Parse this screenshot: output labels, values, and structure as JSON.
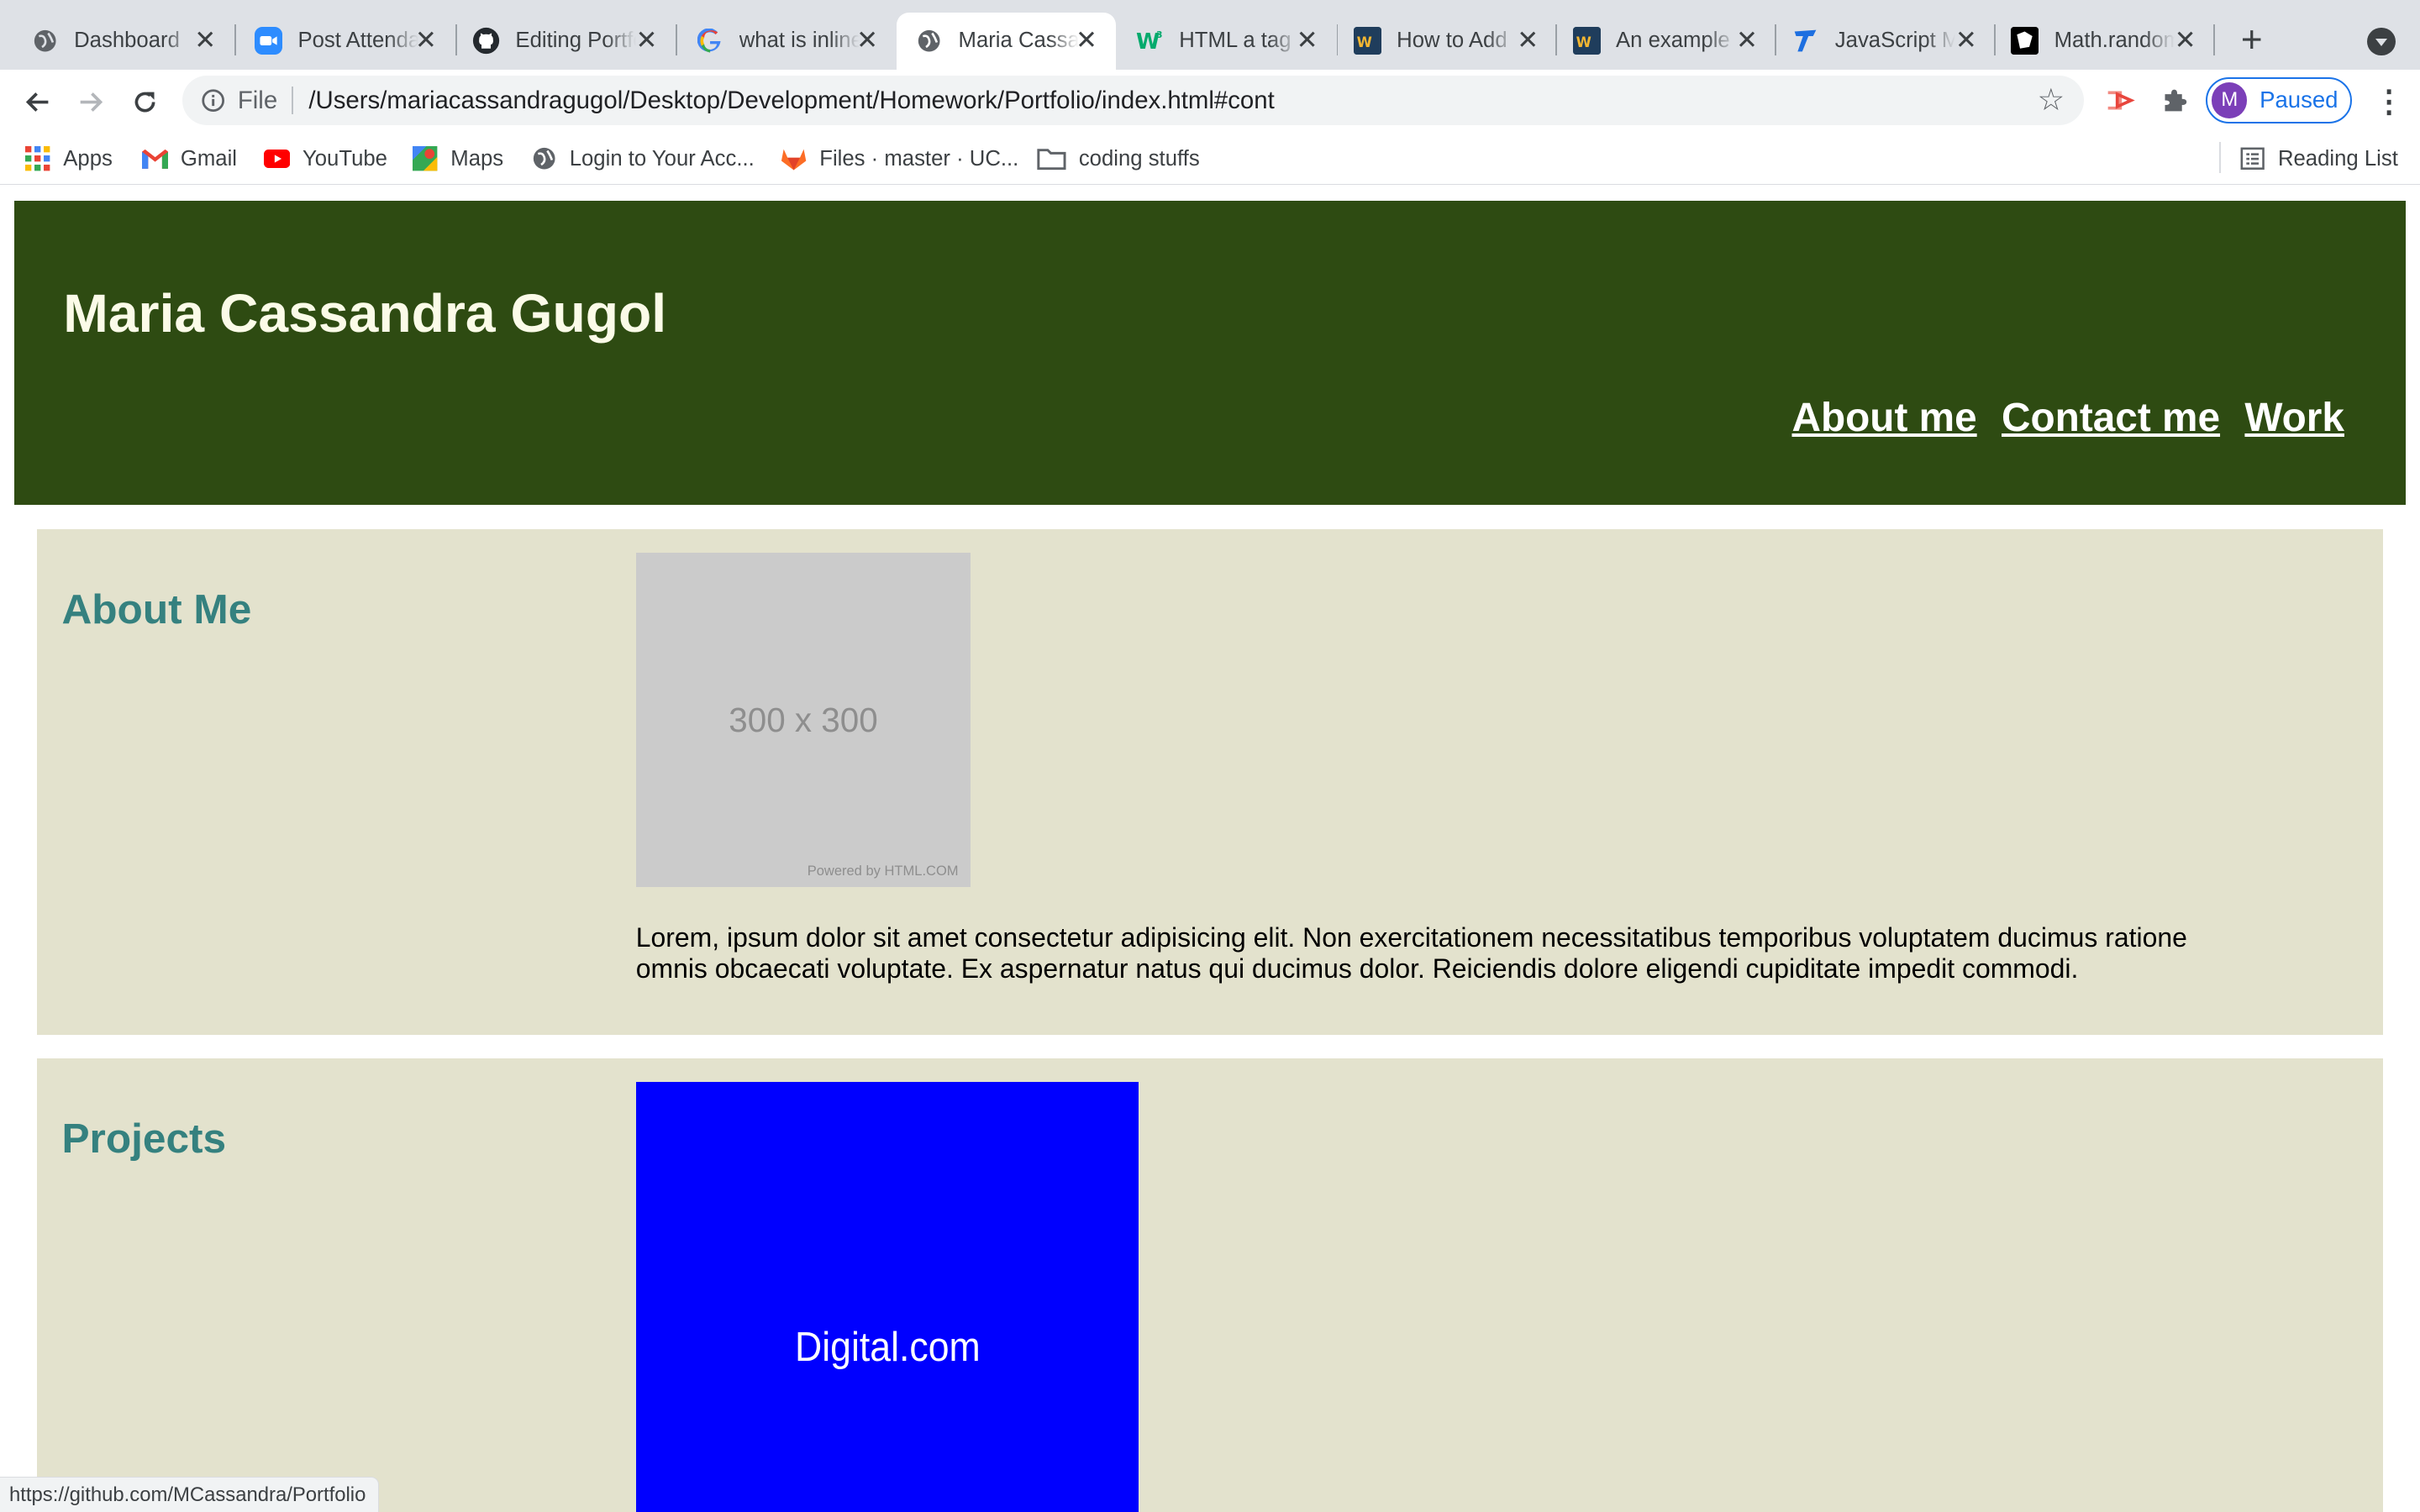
{
  "browser": {
    "tabs": [
      {
        "title": "Dashboard",
        "icon": "globe-icon",
        "active": false
      },
      {
        "title": "Post Attendance",
        "icon": "zoom-icon",
        "active": false
      },
      {
        "title": "Editing Portfolio",
        "icon": "github-icon",
        "active": false
      },
      {
        "title": "what is inline",
        "icon": "google-icon",
        "active": false
      },
      {
        "title": "Maria Cassandra",
        "icon": "globe-icon",
        "active": true
      },
      {
        "title": "HTML a tag",
        "icon": "w3schools-icon",
        "active": false
      },
      {
        "title": "How to Add",
        "icon": "webucator-icon",
        "active": false
      },
      {
        "title": "An example",
        "icon": "webucator-icon",
        "active": false
      },
      {
        "title": "JavaScript Math",
        "icon": "tutorial-icon",
        "active": false
      },
      {
        "title": "Math.random",
        "icon": "mdn-icon",
        "active": false
      }
    ],
    "address_bar": {
      "scheme_label": "File",
      "url": "/Users/mariacassandragugol/Desktop/Development/Homework/Portfolio/index.html#cont"
    },
    "profile": {
      "initial": "M",
      "status": "Paused"
    },
    "bookmarks": [
      {
        "label": "Apps",
        "icon": "apps-grid-icon"
      },
      {
        "label": "Gmail",
        "icon": "gmail-icon"
      },
      {
        "label": "YouTube",
        "icon": "youtube-icon"
      },
      {
        "label": "Maps",
        "icon": "maps-icon"
      },
      {
        "label": "Login to Your Acc...",
        "icon": "globe-icon"
      },
      {
        "label": "Files · master · UC...",
        "icon": "gitlab-icon"
      },
      {
        "label": "coding stuffs",
        "icon": "folder-icon"
      }
    ],
    "reading_list_label": "Reading List",
    "status_url": "https://github.com/MCassandra/Portfolio"
  },
  "page": {
    "site_title": "Maria Cassandra Gugol",
    "nav": [
      "About me",
      "Contact me",
      "Work"
    ],
    "about": {
      "heading": "About Me",
      "image_label": "300 x 300",
      "image_credit": "Powered by HTML.COM",
      "text": "Lorem, ipsum dolor sit amet consectetur adipisicing elit. Non exercitationem necessitatibus temporibus voluptatem ducimus ratione omnis obcaecati voluptate. Ex aspernatur natus qui ducimus dolor. Reiciendis dolore eligendi cupiditate impedit commodi."
    },
    "projects": {
      "heading": "Projects",
      "image_label": "Digital.com"
    }
  },
  "colors": {
    "header_bg": "#2e4b12",
    "section_bg": "#e3e2cd",
    "heading_teal": "#35817f",
    "project_blue": "#0000ff",
    "chrome_accent": "#1a73e8"
  }
}
